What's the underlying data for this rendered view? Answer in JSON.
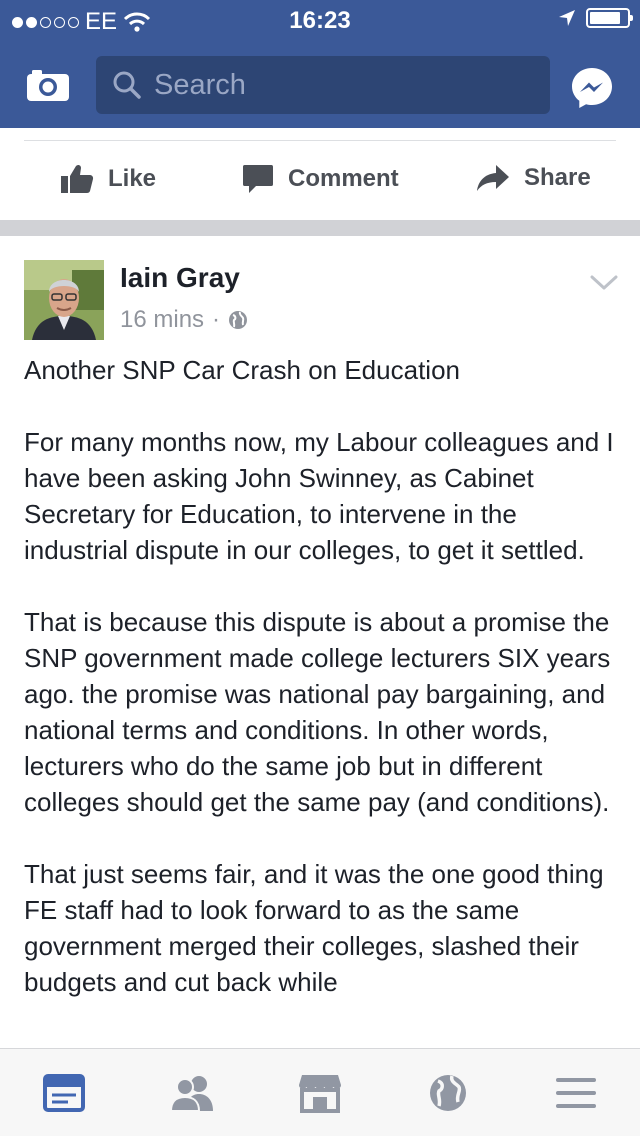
{
  "status_bar": {
    "carrier": "EE",
    "time": "16:23",
    "signal_bars_filled": 2,
    "signal_bars_total": 5
  },
  "header": {
    "search_placeholder": "Search",
    "icons": [
      "camera-icon",
      "search-icon",
      "messenger-icon"
    ],
    "brand_color": "#3b5998"
  },
  "actions": {
    "like_label": "Like",
    "comment_label": "Comment",
    "share_label": "Share"
  },
  "post": {
    "author": "Iain Gray",
    "time": "16 mins",
    "separator": "·",
    "audience_icon": "globe-icon",
    "paragraphs": [
      "Another SNP Car Crash on Education",
      "For many months now, my Labour colleagues and I have been asking John Swinney, as Cabinet Secretary for Education, to intervene in the industrial dispute in our colleges, to get it settled.",
      "That is because this dispute is about a promise the SNP government made college lecturers SIX years ago.  the promise was national pay bargaining, and national terms and conditions.  In other words, lecturers who do the same job but in different colleges should get the same pay (and conditions).",
      "That just seems fair, and it was the one good thing FE staff had to look forward to as the same government merged their colleges, slashed their budgets and cut back while"
    ]
  },
  "tab_bar": {
    "tabs": [
      "news-feed-icon",
      "friends-icon",
      "marketplace-icon",
      "notifications-globe-icon",
      "menu-icon"
    ],
    "active_tab": "news-feed-icon",
    "active_color": "#4267b2",
    "inactive_color": "#9197a3"
  }
}
